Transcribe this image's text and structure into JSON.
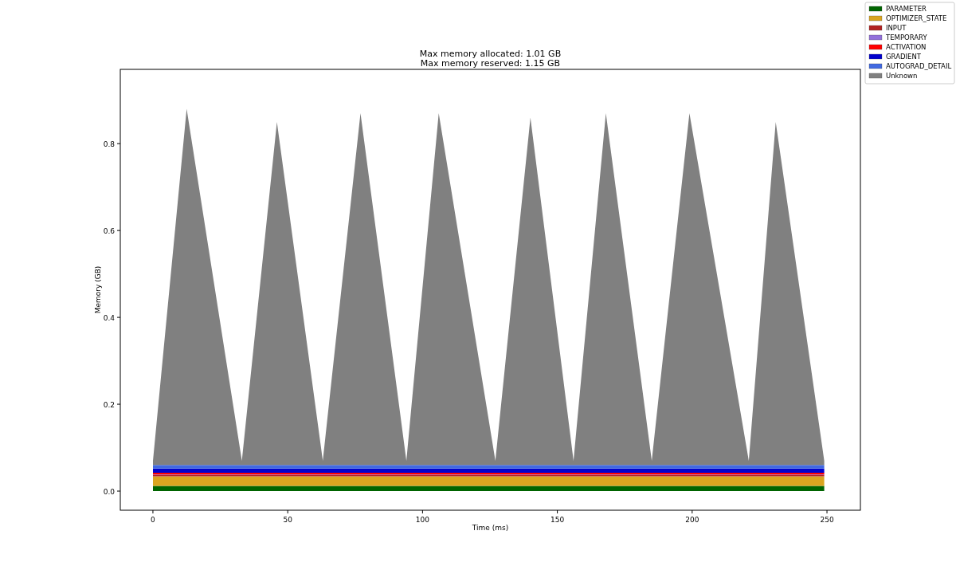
{
  "chart_data": {
    "type": "area",
    "stacked": true,
    "title": "Max memory allocated: 1.01 GB\nMax memory reserved: 1.15 GB",
    "xlabel": "Time (ms)",
    "ylabel": "Memory (GB)",
    "x": [
      0,
      12.5,
      33,
      46,
      63,
      77,
      94,
      106,
      127,
      140,
      156,
      168,
      185,
      199,
      221,
      231,
      249
    ],
    "legend": true,
    "xlim": [
      -12.1,
      262.4
    ],
    "ylim": [
      -0.044,
      0.971
    ],
    "xticks": [
      0,
      50,
      100,
      150,
      200,
      250
    ],
    "yticks": [
      {
        "value": 0,
        "label": "0.0"
      },
      {
        "value": 0.2,
        "label": "0.2"
      },
      {
        "value": 0.4,
        "label": "0.4"
      },
      {
        "value": 0.6,
        "label": "0.6"
      },
      {
        "value": 0.8,
        "label": "0.8"
      }
    ],
    "series": [
      {
        "name": "PARAMETER",
        "color": "#006400",
        "values": [
          0.012,
          0.012,
          0.012,
          0.012,
          0.012,
          0.012,
          0.012,
          0.012,
          0.012,
          0.012,
          0.012,
          0.012,
          0.012,
          0.012,
          0.012,
          0.012,
          0.012
        ]
      },
      {
        "name": "OPTIMIZER_STATE",
        "color": "#daa520",
        "values": [
          0.022,
          0.022,
          0.022,
          0.022,
          0.022,
          0.022,
          0.022,
          0.022,
          0.022,
          0.022,
          0.022,
          0.022,
          0.022,
          0.022,
          0.022,
          0.022,
          0.022
        ]
      },
      {
        "name": "INPUT",
        "color": "#b22222",
        "values": [
          0.003,
          0.003,
          0.003,
          0.003,
          0.003,
          0.003,
          0.003,
          0.003,
          0.003,
          0.003,
          0.003,
          0.003,
          0.003,
          0.003,
          0.003,
          0.003,
          0.003
        ]
      },
      {
        "name": "TEMPORARY",
        "color": "#9370db",
        "values": [
          0.001,
          0.001,
          0.001,
          0.001,
          0.001,
          0.001,
          0.001,
          0.001,
          0.001,
          0.001,
          0.001,
          0.001,
          0.001,
          0.001,
          0.001,
          0.001,
          0.001
        ]
      },
      {
        "name": "ACTIVATION",
        "color": "#ff0000",
        "values": [
          0.004,
          0.004,
          0.004,
          0.004,
          0.004,
          0.004,
          0.004,
          0.004,
          0.004,
          0.004,
          0.004,
          0.004,
          0.004,
          0.004,
          0.004,
          0.004,
          0.004
        ]
      },
      {
        "name": "GRADIENT",
        "color": "#0000cd",
        "values": [
          0.01,
          0.01,
          0.01,
          0.01,
          0.01,
          0.01,
          0.01,
          0.01,
          0.01,
          0.01,
          0.01,
          0.01,
          0.01,
          0.01,
          0.01,
          0.01,
          0.01
        ]
      },
      {
        "name": "AUTOGRAD_DETAIL",
        "color": "#4169e1",
        "values": [
          0.008,
          0.008,
          0.008,
          0.008,
          0.008,
          0.008,
          0.008,
          0.008,
          0.008,
          0.008,
          0.008,
          0.008,
          0.008,
          0.008,
          0.008,
          0.008,
          0.008
        ]
      },
      {
        "name": "Unknown",
        "color": "#808080",
        "values": [
          0.01,
          0.82,
          0.01,
          0.79,
          0.01,
          0.81,
          0.01,
          0.81,
          0.01,
          0.8,
          0.01,
          0.81,
          0.01,
          0.81,
          0.01,
          0.79,
          0.01
        ]
      }
    ]
  }
}
